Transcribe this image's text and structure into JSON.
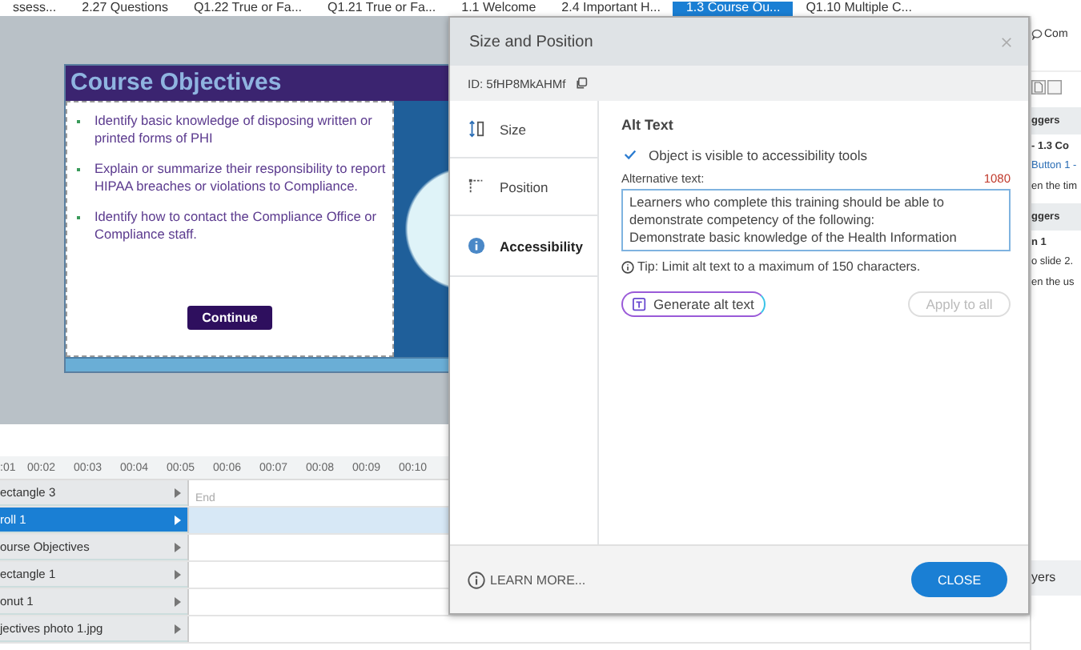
{
  "tabs": [
    {
      "label": "ssess...",
      "selected": false
    },
    {
      "label": "2.27 Questions",
      "selected": false
    },
    {
      "label": "Q1.22 True or Fa...",
      "selected": false
    },
    {
      "label": "Q1.21 True or Fa...",
      "selected": false
    },
    {
      "label": "1.1 Welcome",
      "selected": false
    },
    {
      "label": "2.4 Important H...",
      "selected": false
    },
    {
      "label": "1.3 Course Ou...",
      "selected": true
    },
    {
      "label": "Q1.10 Multiple C...",
      "selected": false
    }
  ],
  "slide": {
    "title": "Course Objectives",
    "bullets": [
      "Identify basic knowledge of disposing written or printed forms of PHI",
      "Explain or summarize their responsibility to report HIPAA breaches or violations to Compliance.",
      "Identify how to contact the Compliance Office or Compliance staff."
    ],
    "button": "Continue"
  },
  "timeline": {
    "ticks": [
      ":01",
      "00:02",
      "00:03",
      "00:04",
      "00:05",
      "00:06",
      "00:07",
      "00:08",
      "00:09",
      "00:10"
    ],
    "end_label": "End",
    "layers": [
      {
        "name": "ectangle 3",
        "selected": false
      },
      {
        "name": "roll 1",
        "selected": true
      },
      {
        "name": "ourse Objectives",
        "selected": false
      },
      {
        "name": "ectangle 1",
        "selected": false
      },
      {
        "name": "onut 1",
        "selected": false
      },
      {
        "name": "jectives photo 1.jpg",
        "selected": false
      }
    ]
  },
  "right_panel": {
    "comments": "Com",
    "lines": [
      {
        "kind": "heading",
        "text": "ggers"
      },
      {
        "kind": "title",
        "text": "- 1.3 Co"
      },
      {
        "kind": "link",
        "text": "Button 1 -"
      },
      {
        "kind": "text",
        "text": "en the tim"
      },
      {
        "kind": "heading",
        "text": "ggers"
      },
      {
        "kind": "title",
        "text": "n 1"
      },
      {
        "kind": "text",
        "text": "o slide 2."
      },
      {
        "kind": "text",
        "text": "en the us"
      }
    ],
    "layers": "yers"
  },
  "dialog": {
    "title": "Size and Position",
    "id": "ID: 5fHP8MkAHMf",
    "nav": [
      {
        "kind": "size",
        "label": "Size",
        "selected": false
      },
      {
        "kind": "position",
        "label": "Position",
        "selected": false
      },
      {
        "kind": "accessibility",
        "label": "Accessibility",
        "selected": true
      }
    ],
    "section_title": "Alt Text",
    "visible_checkbox": {
      "label": "Object is visible to accessibility tools",
      "checked": true
    },
    "alt_label": "Alternative text:",
    "char_count": "1080",
    "alt_text": "Learners who complete this training should be able to\ndemonstrate competency of the following:\nDemonstrate basic knowledge of the Health Information",
    "tip": "Tip: Limit alt text to a maximum of 150 characters.",
    "generate_button": "Generate alt text",
    "apply_button": {
      "label": "Apply to all",
      "disabled": true
    },
    "learn_more": "LEARN MORE...",
    "close_button": "CLOSE"
  }
}
